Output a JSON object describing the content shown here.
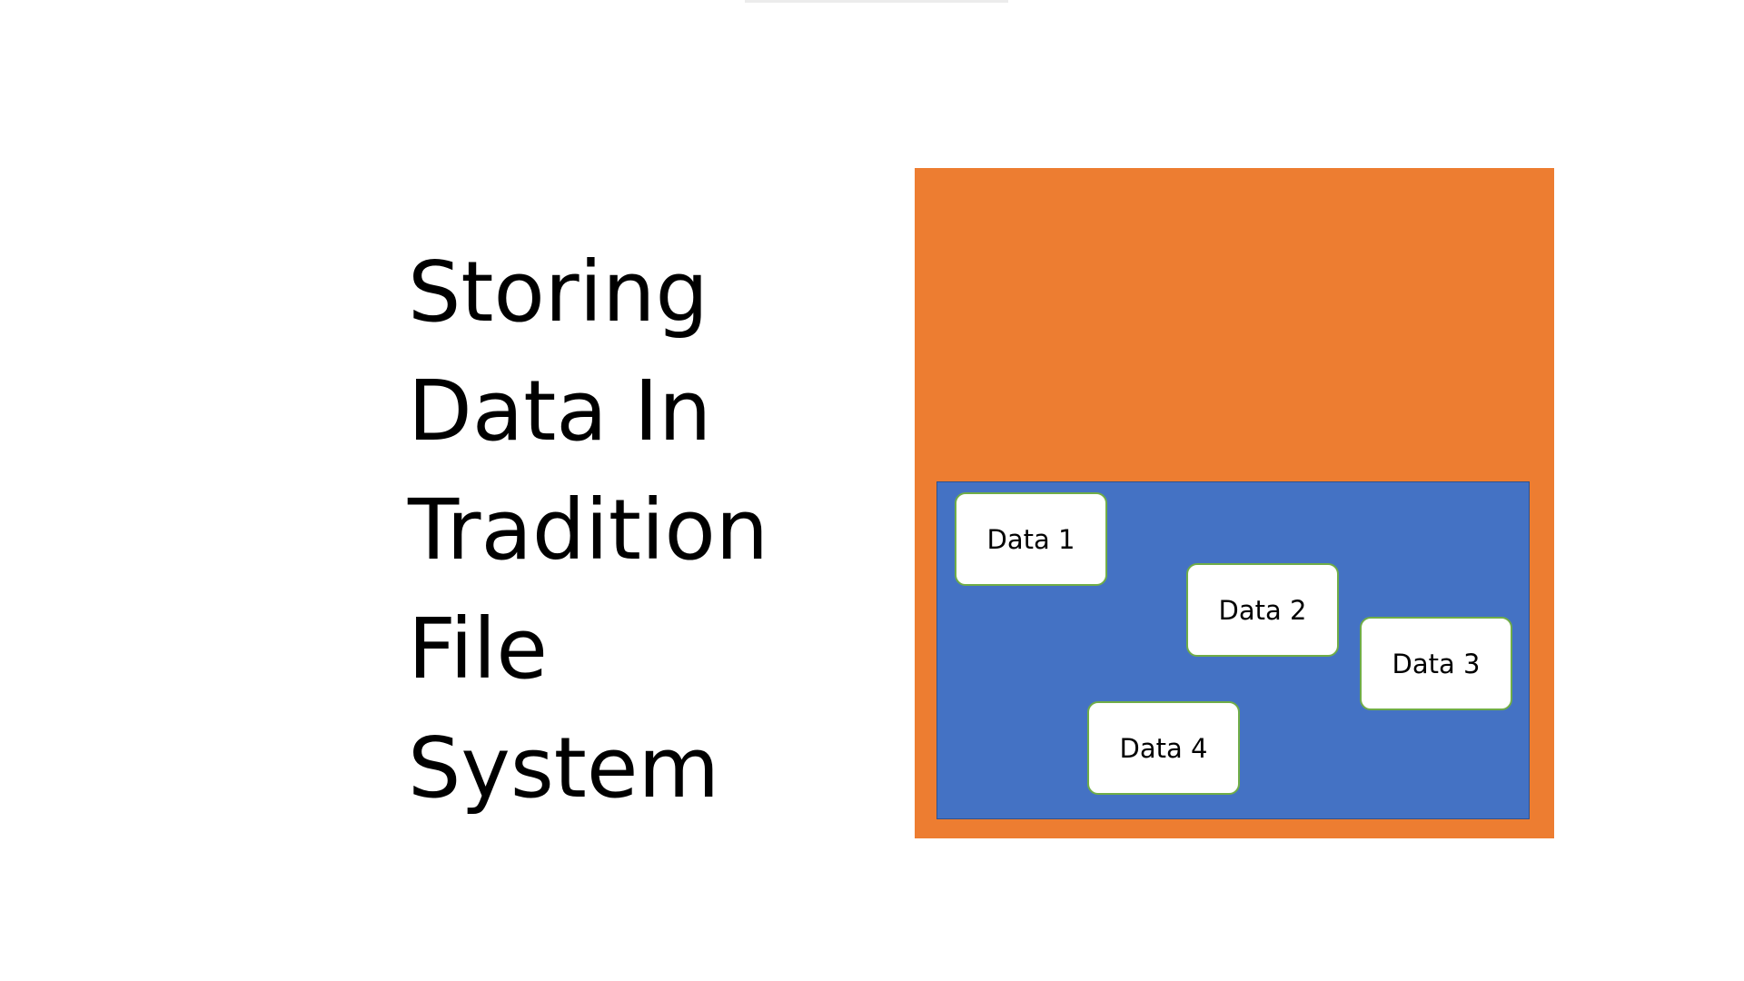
{
  "title": {
    "lines": [
      "Storing",
      "Data In",
      "Tradition",
      "File",
      "System"
    ]
  },
  "diagram": {
    "cards": [
      {
        "label": "Data 1"
      },
      {
        "label": "Data 2"
      },
      {
        "label": "Data 3"
      },
      {
        "label": "Data 4"
      }
    ]
  },
  "colors": {
    "outer_box": "#ed7d31",
    "inner_box": "#4472c4",
    "card_border": "#70ad47",
    "card_fill": "#ffffff",
    "text": "#000000"
  }
}
